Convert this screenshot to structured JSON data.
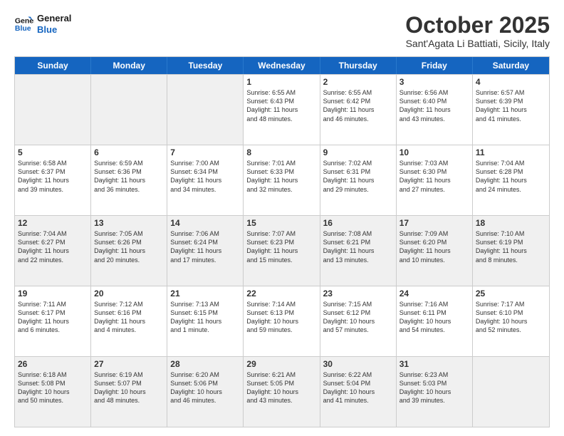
{
  "logo": {
    "line1": "General",
    "line2": "Blue"
  },
  "header": {
    "month": "October 2025",
    "location": "Sant'Agata Li Battiati, Sicily, Italy"
  },
  "weekdays": [
    "Sunday",
    "Monday",
    "Tuesday",
    "Wednesday",
    "Thursday",
    "Friday",
    "Saturday"
  ],
  "rows": [
    [
      {
        "day": "",
        "info": "",
        "shaded": true
      },
      {
        "day": "",
        "info": "",
        "shaded": true
      },
      {
        "day": "",
        "info": "",
        "shaded": true
      },
      {
        "day": "1",
        "info": "Sunrise: 6:55 AM\nSunset: 6:43 PM\nDaylight: 11 hours\nand 48 minutes."
      },
      {
        "day": "2",
        "info": "Sunrise: 6:55 AM\nSunset: 6:42 PM\nDaylight: 11 hours\nand 46 minutes."
      },
      {
        "day": "3",
        "info": "Sunrise: 6:56 AM\nSunset: 6:40 PM\nDaylight: 11 hours\nand 43 minutes."
      },
      {
        "day": "4",
        "info": "Sunrise: 6:57 AM\nSunset: 6:39 PM\nDaylight: 11 hours\nand 41 minutes."
      }
    ],
    [
      {
        "day": "5",
        "info": "Sunrise: 6:58 AM\nSunset: 6:37 PM\nDaylight: 11 hours\nand 39 minutes."
      },
      {
        "day": "6",
        "info": "Sunrise: 6:59 AM\nSunset: 6:36 PM\nDaylight: 11 hours\nand 36 minutes."
      },
      {
        "day": "7",
        "info": "Sunrise: 7:00 AM\nSunset: 6:34 PM\nDaylight: 11 hours\nand 34 minutes."
      },
      {
        "day": "8",
        "info": "Sunrise: 7:01 AM\nSunset: 6:33 PM\nDaylight: 11 hours\nand 32 minutes."
      },
      {
        "day": "9",
        "info": "Sunrise: 7:02 AM\nSunset: 6:31 PM\nDaylight: 11 hours\nand 29 minutes."
      },
      {
        "day": "10",
        "info": "Sunrise: 7:03 AM\nSunset: 6:30 PM\nDaylight: 11 hours\nand 27 minutes."
      },
      {
        "day": "11",
        "info": "Sunrise: 7:04 AM\nSunset: 6:28 PM\nDaylight: 11 hours\nand 24 minutes."
      }
    ],
    [
      {
        "day": "12",
        "info": "Sunrise: 7:04 AM\nSunset: 6:27 PM\nDaylight: 11 hours\nand 22 minutes.",
        "shaded": true
      },
      {
        "day": "13",
        "info": "Sunrise: 7:05 AM\nSunset: 6:26 PM\nDaylight: 11 hours\nand 20 minutes.",
        "shaded": true
      },
      {
        "day": "14",
        "info": "Sunrise: 7:06 AM\nSunset: 6:24 PM\nDaylight: 11 hours\nand 17 minutes.",
        "shaded": true
      },
      {
        "day": "15",
        "info": "Sunrise: 7:07 AM\nSunset: 6:23 PM\nDaylight: 11 hours\nand 15 minutes.",
        "shaded": true
      },
      {
        "day": "16",
        "info": "Sunrise: 7:08 AM\nSunset: 6:21 PM\nDaylight: 11 hours\nand 13 minutes.",
        "shaded": true
      },
      {
        "day": "17",
        "info": "Sunrise: 7:09 AM\nSunset: 6:20 PM\nDaylight: 11 hours\nand 10 minutes.",
        "shaded": true
      },
      {
        "day": "18",
        "info": "Sunrise: 7:10 AM\nSunset: 6:19 PM\nDaylight: 11 hours\nand 8 minutes.",
        "shaded": true
      }
    ],
    [
      {
        "day": "19",
        "info": "Sunrise: 7:11 AM\nSunset: 6:17 PM\nDaylight: 11 hours\nand 6 minutes."
      },
      {
        "day": "20",
        "info": "Sunrise: 7:12 AM\nSunset: 6:16 PM\nDaylight: 11 hours\nand 4 minutes."
      },
      {
        "day": "21",
        "info": "Sunrise: 7:13 AM\nSunset: 6:15 PM\nDaylight: 11 hours\nand 1 minute."
      },
      {
        "day": "22",
        "info": "Sunrise: 7:14 AM\nSunset: 6:13 PM\nDaylight: 10 hours\nand 59 minutes."
      },
      {
        "day": "23",
        "info": "Sunrise: 7:15 AM\nSunset: 6:12 PM\nDaylight: 10 hours\nand 57 minutes."
      },
      {
        "day": "24",
        "info": "Sunrise: 7:16 AM\nSunset: 6:11 PM\nDaylight: 10 hours\nand 54 minutes."
      },
      {
        "day": "25",
        "info": "Sunrise: 7:17 AM\nSunset: 6:10 PM\nDaylight: 10 hours\nand 52 minutes."
      }
    ],
    [
      {
        "day": "26",
        "info": "Sunrise: 6:18 AM\nSunset: 5:08 PM\nDaylight: 10 hours\nand 50 minutes.",
        "shaded": true
      },
      {
        "day": "27",
        "info": "Sunrise: 6:19 AM\nSunset: 5:07 PM\nDaylight: 10 hours\nand 48 minutes.",
        "shaded": true
      },
      {
        "day": "28",
        "info": "Sunrise: 6:20 AM\nSunset: 5:06 PM\nDaylight: 10 hours\nand 46 minutes.",
        "shaded": true
      },
      {
        "day": "29",
        "info": "Sunrise: 6:21 AM\nSunset: 5:05 PM\nDaylight: 10 hours\nand 43 minutes.",
        "shaded": true
      },
      {
        "day": "30",
        "info": "Sunrise: 6:22 AM\nSunset: 5:04 PM\nDaylight: 10 hours\nand 41 minutes.",
        "shaded": true
      },
      {
        "day": "31",
        "info": "Sunrise: 6:23 AM\nSunset: 5:03 PM\nDaylight: 10 hours\nand 39 minutes.",
        "shaded": true
      },
      {
        "day": "",
        "info": "",
        "shaded": true
      }
    ]
  ]
}
